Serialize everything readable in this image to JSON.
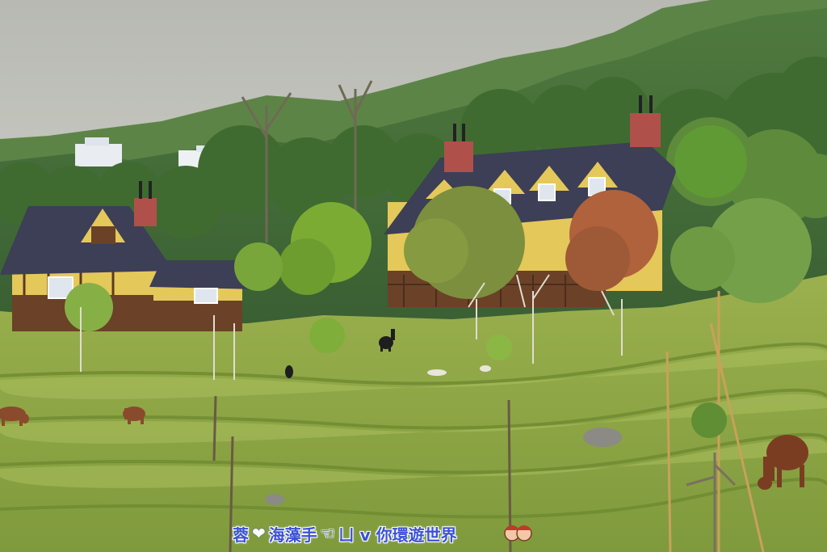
{
  "photo": {
    "subject": "hillside-farm-with-alpacas-and-european-style-houses"
  },
  "watermark": {
    "text_left": "蓉",
    "text_middle": "海藻手",
    "text_right": "ㄩ v 你環遊世界",
    "text_color": "#3b52d6"
  },
  "colors": {
    "sky": "#bfc2bb",
    "roof": "#3c3f55",
    "chimney": "#b0504a",
    "grass": "#8fa64a",
    "alpaca_brown": "#7a3d22"
  }
}
